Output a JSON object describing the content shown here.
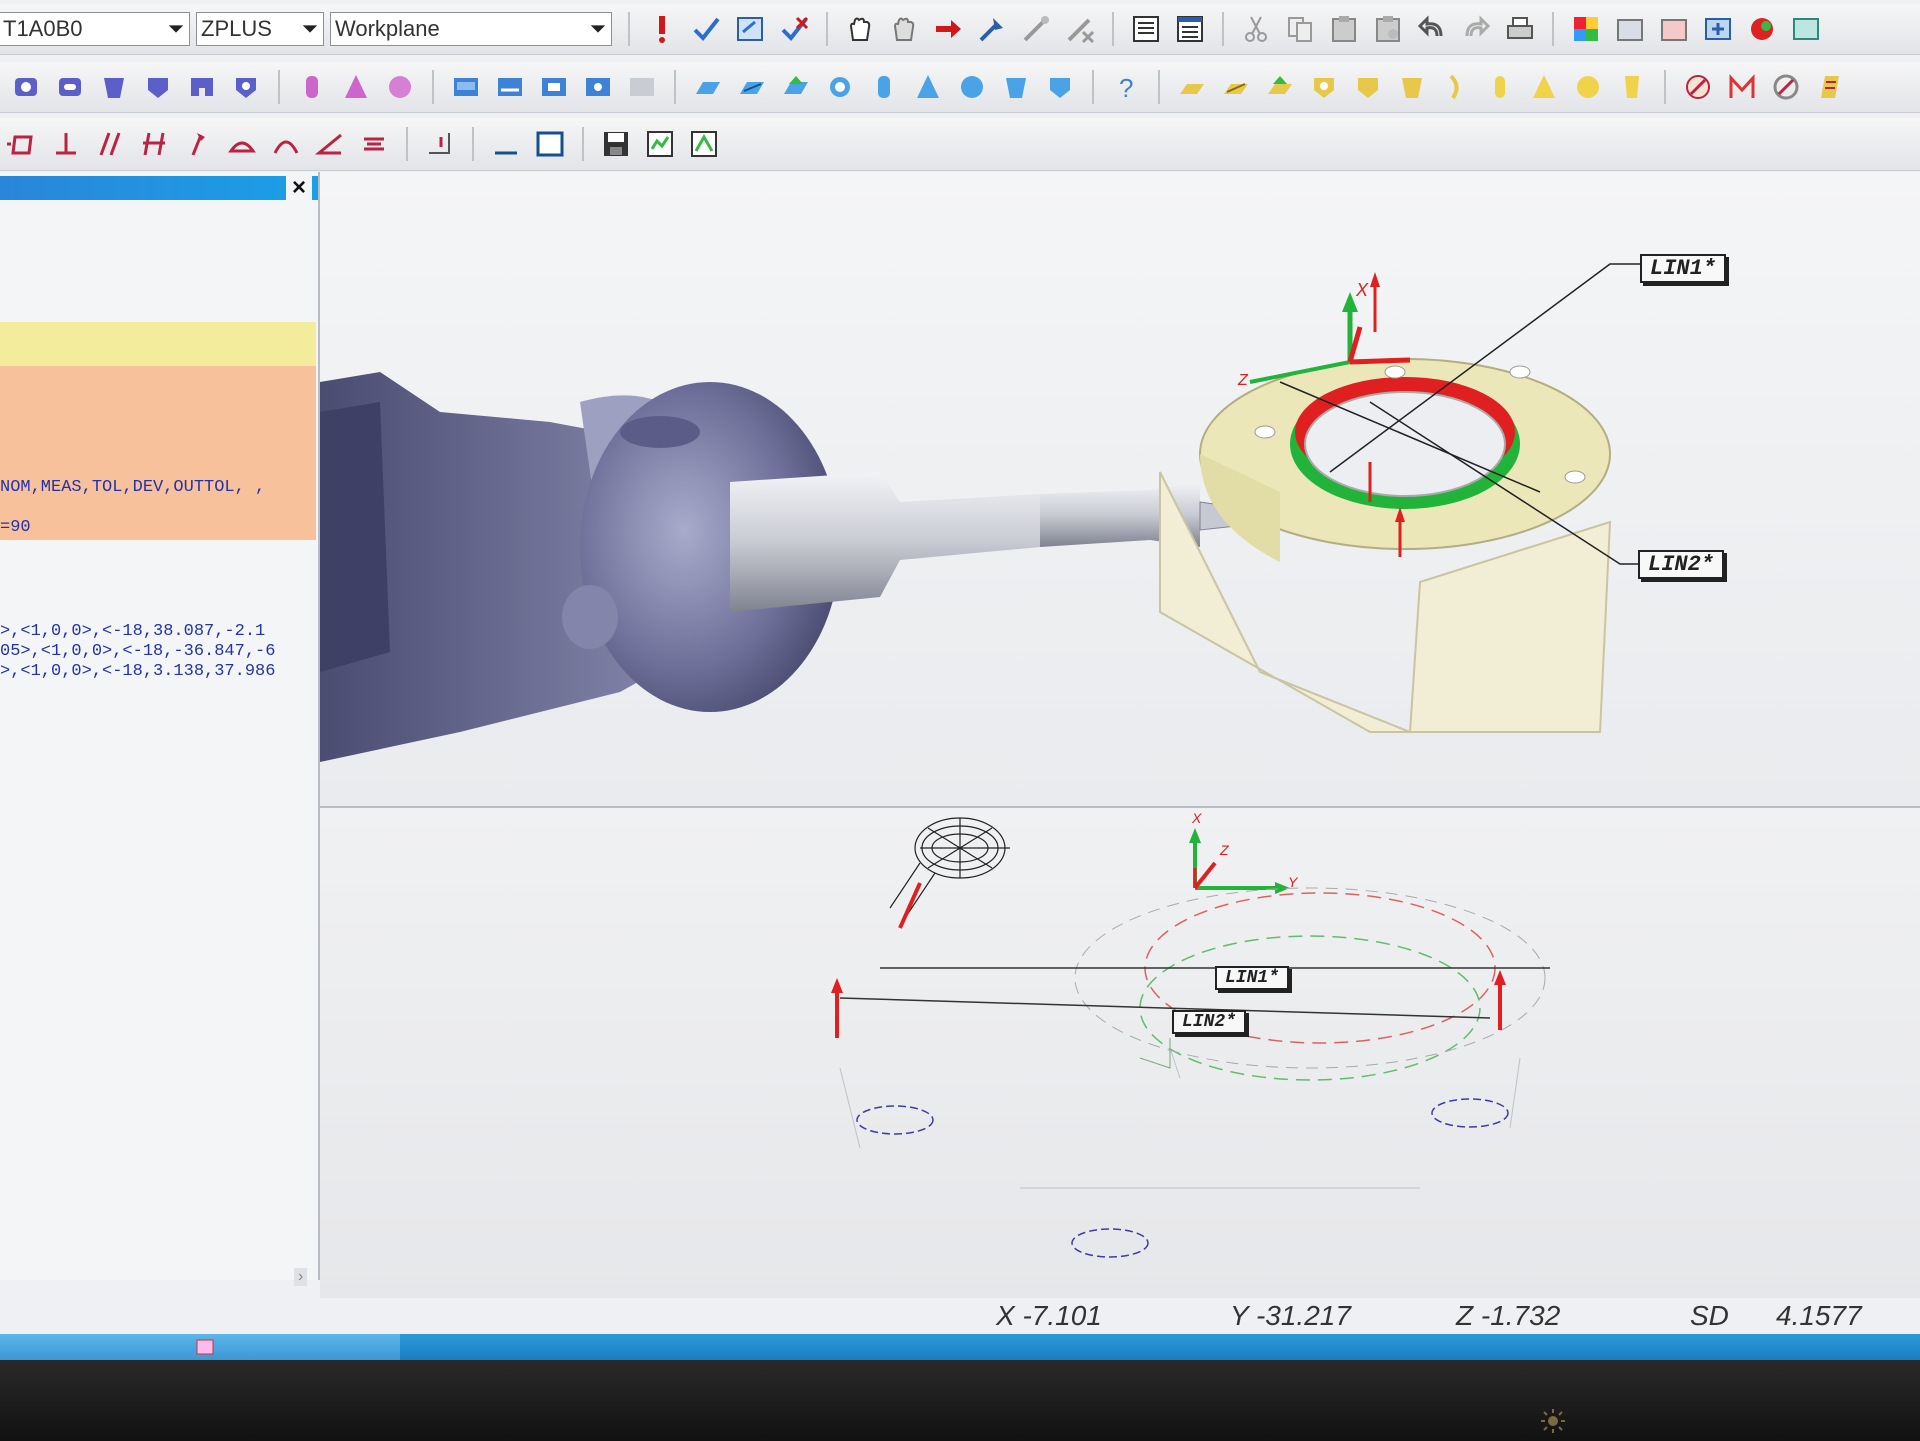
{
  "toolbar": {
    "probe_combo": "T1A0B0",
    "view_combo": "ZPLUS",
    "workplane_combo": "Workplane",
    "row1_icons": [
      "execute-icon",
      "mark-icon",
      "edit-window-icon",
      "unmark-icon",
      "pan-hand-icon",
      "rotate-hand-icon",
      "arrow-icon",
      "probe-icon",
      "move-icon",
      "delete-icon",
      "report-icon",
      "list-icon",
      "cut-icon",
      "copy-icon",
      "paste-icon",
      "paste-special-icon",
      "undo-icon",
      "redo-icon",
      "print-icon",
      "color-icon",
      "graphics-icon",
      "settings-icon",
      "window-icon",
      "sphere-render-icon",
      "export-icon"
    ],
    "row2_icons": [
      "circle-icon",
      "slot-icon",
      "cylinder-icon",
      "cone-icon",
      "square-icon",
      "polygon-icon",
      "cylinder-auto-icon",
      "cone-auto-icon",
      "sphere-icon",
      "plane-icon",
      "line-icon",
      "point-icon",
      "measure-icon",
      "disabled-icon",
      "auto-plane-icon",
      "auto-line-icon",
      "auto-point-icon",
      "auto-circle-icon",
      "auto-cylinder-icon",
      "auto-cone-icon",
      "auto-sphere-icon",
      "auto-slot-icon",
      "auto-square-icon",
      "help-icon",
      "construct-plane-icon",
      "construct-line-icon",
      "construct-point-icon",
      "construct-circle-icon",
      "construct-slot-icon",
      "construct-square-icon",
      "construct-curve-icon",
      "construct-cylinder-icon",
      "construct-cone-icon",
      "construct-sphere-icon",
      "construct-set-icon",
      "dimension-icon",
      "profile-icon",
      "analysis-icon",
      "report-gen-icon"
    ],
    "row3_icons": [
      "flatness-icon",
      "perpendicular-icon",
      "parallel-icon",
      "profile-line-icon",
      "runout-icon",
      "arc-icon",
      "round-icon",
      "angle-icon",
      "symmetry-icon",
      "datum-icon",
      "line-style-icon",
      "rectangle-icon",
      "save-icon",
      "report-view-icon",
      "cad-view-icon"
    ]
  },
  "left_panel": {
    "close_label": "×",
    "code_line_1": "NOM,MEAS,TOL,DEV,OUTTOL, ,",
    "code_line_2": "=90",
    "code_line_3": ">,<1,0,0>,<-18,38.087,-2.1",
    "code_line_4": "05>,<1,0,0>,<-18,-36.847,-6",
    "code_line_5": ">,<1,0,0>,<-18,3.138,37.986",
    "scroll_glyph": "›"
  },
  "viewport_top": {
    "label_lin1": "LIN1*",
    "label_lin2": "LIN2*",
    "axis_x": "X",
    "axis_z": "Z"
  },
  "viewport_bottom": {
    "label_lin1": "LIN1*",
    "label_lin2": "LIN2*",
    "axis_x": "X",
    "axis_z": "Z",
    "axis_y": "Y"
  },
  "status": {
    "x": "X -7.101",
    "y": "Y -31.217",
    "z": "Z -1.732",
    "sd_label": "SD",
    "sd_value": "4.1577"
  },
  "colors": {
    "accent_blue": "#1a8ad8",
    "measured_red": "#e02020",
    "measured_green": "#22b43a",
    "part_yellow": "#ece7b8",
    "probe_body": "#8a8cb0"
  }
}
